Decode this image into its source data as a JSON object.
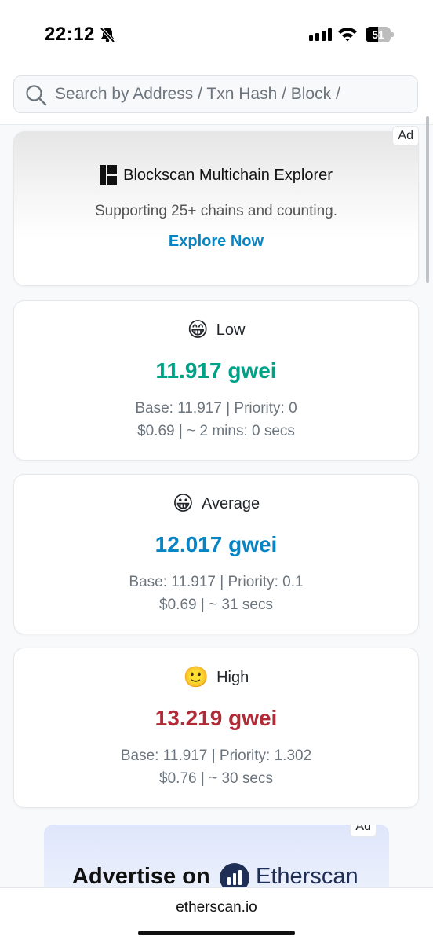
{
  "status_bar": {
    "time": "22:12",
    "battery": "51",
    "battery_level": 0.51,
    "icons": [
      "bell-slash-icon",
      "signal-icon",
      "wifi-icon",
      "battery-icon"
    ]
  },
  "search": {
    "placeholder": "Search by Address / Txn Hash / Block /",
    "icon": "search-icon"
  },
  "ad_top": {
    "badge": "Ad",
    "title": "Blockscan Multichain Explorer",
    "subtitle": "Supporting 25+ chains and counting.",
    "link": "Explore Now",
    "logo": "blockscan-logo"
  },
  "gas": [
    {
      "emoji": "😁",
      "label": "Low",
      "price": "11.917 gwei",
      "base": "Base: 11.917 | Priority: 0",
      "cost": "$0.69 | ~ 2 mins: 0 secs",
      "color": "#00a186"
    },
    {
      "emoji": "😀",
      "label": "Average",
      "price": "12.017 gwei",
      "base": "Base: 11.917 | Priority: 0.1",
      "cost": "$0.69 | ~ 31 secs",
      "color": "#0784c3"
    },
    {
      "emoji": "🙂",
      "label": "High",
      "price": "13.219 gwei",
      "base": "Base: 11.917 | Priority: 1.302",
      "cost": "$0.76 | ~ 30 secs",
      "color": "#b02a37"
    }
  ],
  "ad_bottom": {
    "badge": "Ad",
    "text": "Advertise on",
    "brand": "Etherscan",
    "logo": "etherscan-logo"
  },
  "bottom": {
    "domain": "etherscan.io"
  }
}
